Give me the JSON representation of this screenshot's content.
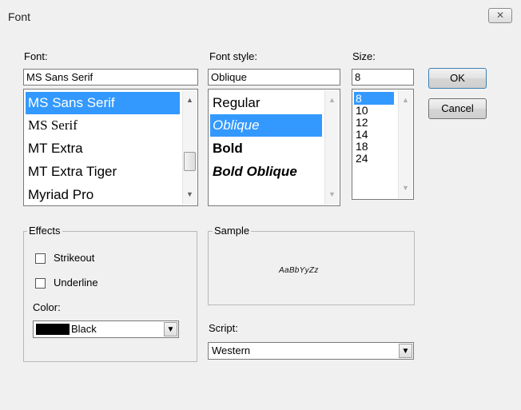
{
  "window": {
    "title": "Font",
    "close_glyph": "✕"
  },
  "font": {
    "label": "Font:",
    "value": "MS Sans Serif",
    "items": [
      "MS Sans Serif",
      "MS Serif",
      "MT Extra",
      "MT Extra Tiger",
      "Myriad Pro"
    ]
  },
  "font_style": {
    "label": "Font style:",
    "value": "Oblique",
    "items": [
      "Regular",
      "Oblique",
      "Bold",
      "Bold Oblique"
    ]
  },
  "size": {
    "label": "Size:",
    "value": "8",
    "items": [
      "8",
      "10",
      "12",
      "14",
      "18",
      "24"
    ]
  },
  "buttons": {
    "ok": "OK",
    "cancel": "Cancel"
  },
  "effects": {
    "label": "Effects",
    "strikeout": "Strikeout",
    "underline": "Underline",
    "color_label": "Color:",
    "color_value": "Black",
    "swatch_color": "#000000"
  },
  "sample": {
    "label": "Sample",
    "text": "AaBbYyZz"
  },
  "script": {
    "label": "Script:",
    "value": "Western"
  },
  "colors": {
    "selection": "#3399ff",
    "selection_text": "#ffffff"
  }
}
